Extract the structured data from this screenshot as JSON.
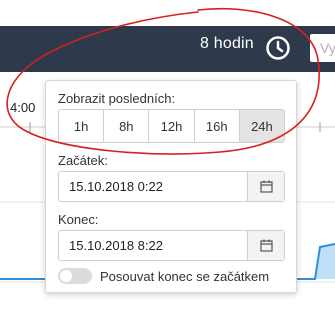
{
  "topbar": {
    "range_label": "8 hodin",
    "clock_icon": "clock-icon",
    "search_partial": "Vy"
  },
  "background": {
    "tick_label": "4:00"
  },
  "popover": {
    "show_last_label": "Zobrazit posledních:",
    "ranges": [
      {
        "label": "1h",
        "active": false
      },
      {
        "label": "8h",
        "active": false
      },
      {
        "label": "12h",
        "active": false
      },
      {
        "label": "16h",
        "active": false
      },
      {
        "label": "24h",
        "active": true
      }
    ],
    "start": {
      "label": "Začátek:",
      "value": "15.10.2018 0:22",
      "icon": "calendar-icon"
    },
    "end": {
      "label": "Konec:",
      "value": "15.10.2018 8:22",
      "icon": "calendar-icon"
    },
    "toggle": {
      "label": "Posouvat konec se začátkem",
      "on": false
    }
  },
  "colors": {
    "topbar_bg": "#2e3a4b",
    "annotation_red": "#d62020",
    "chart_line": "#2f8fd8",
    "active_segment": "#e4e4e4"
  }
}
